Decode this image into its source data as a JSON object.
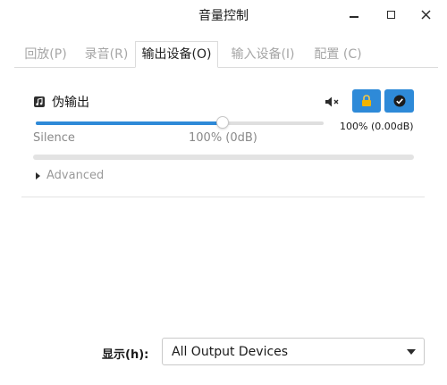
{
  "window": {
    "title": "音量控制",
    "controls": [
      "minimize-icon",
      "maximize-icon",
      "close-icon"
    ]
  },
  "tabs": [
    {
      "label": "回放(P)",
      "active": false
    },
    {
      "label": "录音(R)",
      "active": false
    },
    {
      "label": "输出设备(O)",
      "active": true
    },
    {
      "label": "输入设备(I)",
      "active": false
    },
    {
      "label": "配置 (C)",
      "active": false
    }
  ],
  "device": {
    "icon": "music-note-icon",
    "name": "伪输出",
    "volume_fraction": 0.65,
    "volume_readout": "100% (0.00dB)",
    "mark_min": "Silence",
    "mark_100": "100% (0dB)",
    "muted": false,
    "locked": true,
    "default": true,
    "advanced_label": "Advanced"
  },
  "footer": {
    "show_label": "显示(h):",
    "show_value": "All Output Devices"
  },
  "colors": {
    "accent": "#2e8ad8",
    "lock": "#f2b400"
  }
}
